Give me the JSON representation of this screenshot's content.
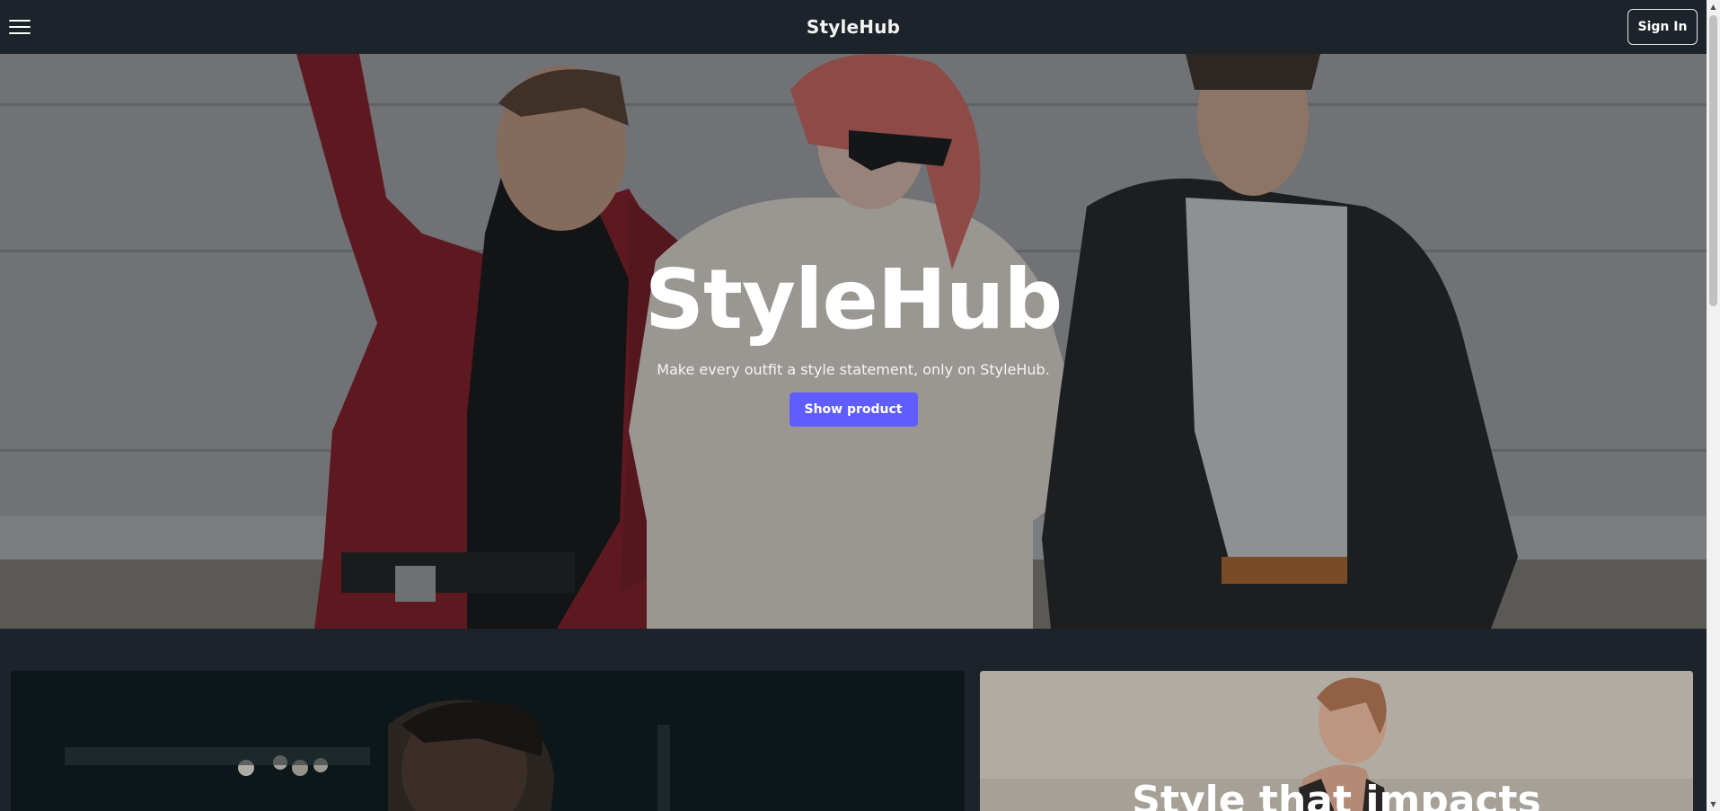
{
  "navbar": {
    "brand": "StyleHub",
    "sign_in_label": "Sign In",
    "menu_icon": "hamburger-menu-icon"
  },
  "hero": {
    "title": "StyleHub",
    "subtitle": "Make every outfit a style statement, only on StyleHub.",
    "cta_label": "Show product",
    "image": "three-models-fashion-photo"
  },
  "cards": {
    "left": {
      "image": "man-portrait-dark-photo"
    },
    "right": {
      "image": "woman-portrait-photo",
      "title": "Style that impacts"
    }
  },
  "colors": {
    "background": "#1d232a",
    "primary_button": "#605dff",
    "text": "#ffffff"
  }
}
